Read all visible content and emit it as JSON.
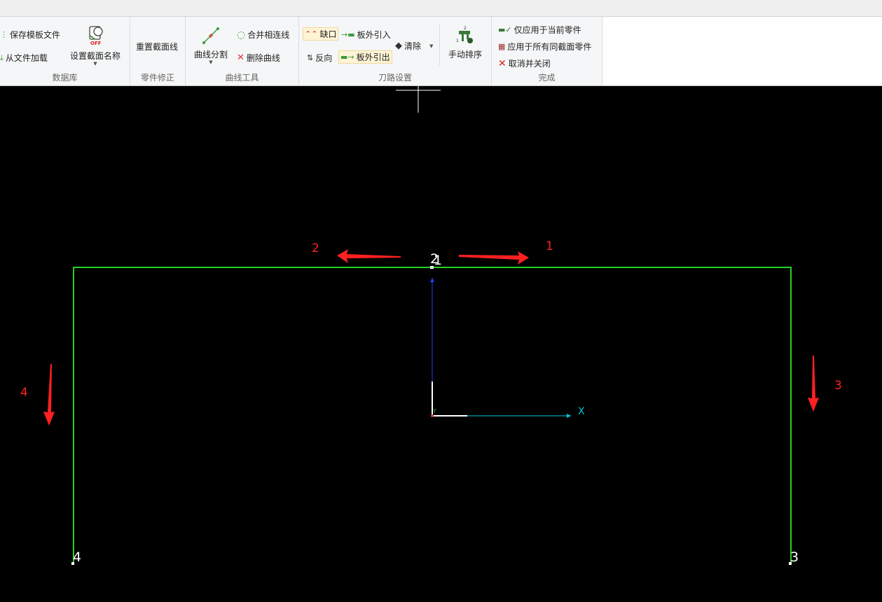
{
  "ribbon": {
    "groups": {
      "database": {
        "label": "数据库",
        "save_template": "保存模板文件",
        "load_from_file": "从文件加载",
        "set_section_name": "设置截面名称",
        "off_badge": "OFF"
      },
      "part_fix": {
        "label": "零件修正",
        "reset_section": "重置截面线"
      },
      "curve_tools": {
        "label": "曲线工具",
        "split_curve": "曲线分割",
        "merge_lines": "合并相连线",
        "delete_curve": "删除曲线"
      },
      "toolpath": {
        "label": "刀路设置",
        "notch": "缺口",
        "lead_in": "板外引入",
        "clear": "清除",
        "reverse": "反向",
        "lead_out": "板外引出",
        "manual_sort": "手动排序"
      },
      "finish": {
        "label": "完成",
        "apply_current": "仅应用于当前零件",
        "apply_all": "应用于所有同截面零件",
        "cancel_close": "取消并关闭"
      }
    }
  },
  "viewport": {
    "vertex_labels": {
      "top": "2",
      "top_overlap": "1",
      "left_bottom": "4",
      "right_bottom": "3"
    },
    "annotations": {
      "left_arrow_num": "2",
      "right_arrow_num": "1",
      "right_side_num": "3",
      "left_side_num": "4"
    },
    "axis": {
      "x_label": "X",
      "y_label": "Y"
    },
    "colors": {
      "profile": "#21d321",
      "annotation": "#ff2020",
      "x_axis": "#00c8e0",
      "y_axis": "#2040ff"
    }
  }
}
